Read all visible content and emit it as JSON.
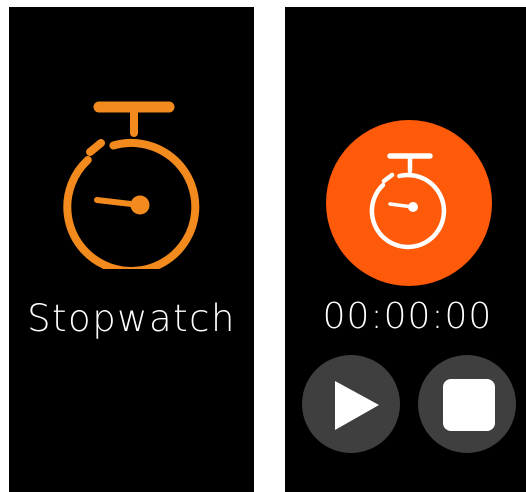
{
  "colors": {
    "accent_orange": "#f28a1e",
    "hero_orange": "#ff5a0a",
    "button_gray": "#3f3f3f",
    "text_white": "#ffffff",
    "background": "#000000"
  },
  "screen_left": {
    "app_icon": "stopwatch-icon",
    "app_label": "Stopwatch"
  },
  "screen_right": {
    "hero_icon": "stopwatch-icon",
    "time_display": "00:00:00",
    "controls": [
      {
        "icon": "play-icon"
      },
      {
        "icon": "stop-icon"
      }
    ]
  }
}
